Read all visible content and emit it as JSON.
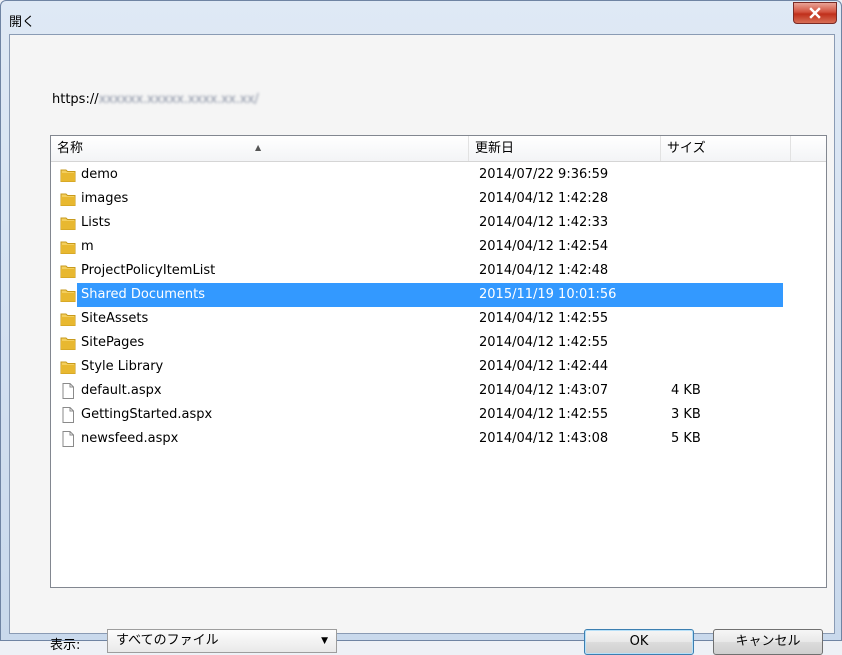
{
  "window": {
    "title": "開く"
  },
  "location": {
    "prefix": "https://",
    "host_blurred": "xxxxxx.xxxxx.xxxx.xx.xx/"
  },
  "columns": {
    "name": "名称",
    "modified": "更新日",
    "size": "サイズ"
  },
  "files": [
    {
      "name": "demo",
      "modified": "2014/07/22 9:36:59",
      "size": "",
      "icon": "folder-icon"
    },
    {
      "name": "images",
      "modified": "2014/04/12 1:42:28",
      "size": "",
      "icon": "folder-icon"
    },
    {
      "name": "Lists",
      "modified": "2014/04/12 1:42:33",
      "size": "",
      "icon": "folder-icon"
    },
    {
      "name": "m",
      "modified": "2014/04/12 1:42:54",
      "size": "",
      "icon": "folder-icon"
    },
    {
      "name": "ProjectPolicyItemList",
      "modified": "2014/04/12 1:42:48",
      "size": "",
      "icon": "folder-icon"
    },
    {
      "name": "Shared Documents",
      "modified": "2015/11/19 10:01:56",
      "size": "",
      "icon": "folder-icon",
      "selected": true
    },
    {
      "name": "SiteAssets",
      "modified": "2014/04/12 1:42:55",
      "size": "",
      "icon": "folder-icon"
    },
    {
      "name": "SitePages",
      "modified": "2014/04/12 1:42:55",
      "size": "",
      "icon": "folder-icon"
    },
    {
      "name": "Style Library",
      "modified": "2014/04/12 1:42:44",
      "size": "",
      "icon": "folder-icon"
    },
    {
      "name": "default.aspx",
      "modified": "2014/04/12 1:43:07",
      "size": "4 KB",
      "icon": "file-icon"
    },
    {
      "name": "GettingStarted.aspx",
      "modified": "2014/04/12 1:42:55",
      "size": "3 KB",
      "icon": "file-icon"
    },
    {
      "name": "newsfeed.aspx",
      "modified": "2014/04/12 1:43:08",
      "size": "5 KB",
      "icon": "file-icon"
    }
  ],
  "footer": {
    "filter_label": "表示:",
    "filter_value": "すべてのファイル",
    "ok_label": "OK",
    "cancel_label": "キャンセル"
  },
  "colors": {
    "selection": "#3399ff",
    "folder": "#e8b830",
    "close_button": "#c7402d"
  }
}
